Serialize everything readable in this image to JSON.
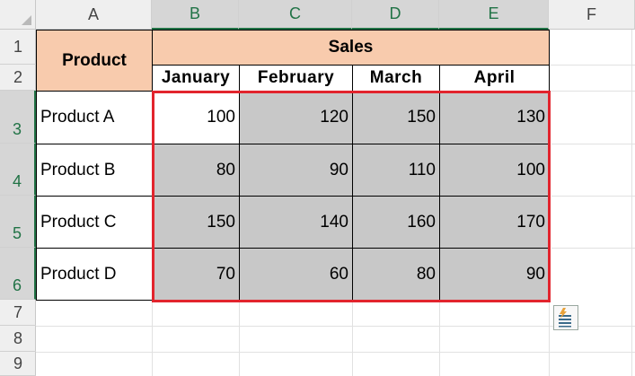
{
  "columns": [
    "A",
    "B",
    "C",
    "D",
    "E",
    "F"
  ],
  "rows": [
    "1",
    "2",
    "3",
    "4",
    "5",
    "6",
    "7",
    "8",
    "9"
  ],
  "table": {
    "product_header": "Product",
    "sales_header": "Sales",
    "months": [
      "January",
      "February",
      "March",
      "April"
    ],
    "products": [
      {
        "name": "Product A",
        "values": [
          "100",
          "120",
          "150",
          "130"
        ]
      },
      {
        "name": "Product B",
        "values": [
          "80",
          "90",
          "110",
          "100"
        ]
      },
      {
        "name": "Product C",
        "values": [
          "150",
          "140",
          "160",
          "170"
        ]
      },
      {
        "name": "Product D",
        "values": [
          "70",
          "60",
          "80",
          "90"
        ]
      }
    ]
  },
  "colors": {
    "header_fill": "#f8cbad",
    "selected_fill": "#c8c8c8",
    "selection_border": "#e2242d",
    "header_highlight": "#217346"
  },
  "quick_analysis": {
    "icon": "quick-analysis-icon"
  }
}
